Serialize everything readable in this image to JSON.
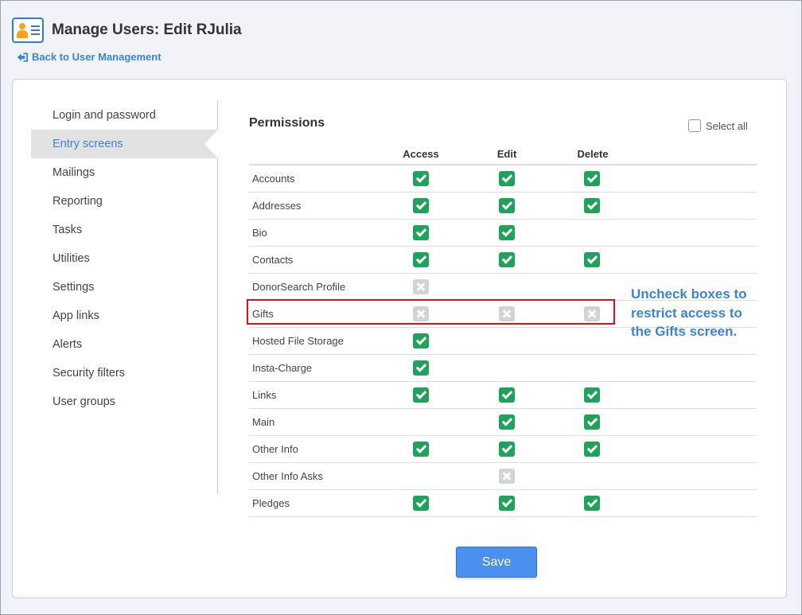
{
  "header": {
    "title": "Manage Users: Edit",
    "user": "RJulia",
    "back_label": "Back to User Management"
  },
  "sidebar": {
    "items": [
      {
        "label": "Login and password"
      },
      {
        "label": "Entry screens",
        "active": true
      },
      {
        "label": "Mailings"
      },
      {
        "label": "Reporting"
      },
      {
        "label": "Tasks"
      },
      {
        "label": "Utilities"
      },
      {
        "label": "Settings"
      },
      {
        "label": "App links"
      },
      {
        "label": "Alerts"
      },
      {
        "label": "Security filters"
      },
      {
        "label": "User groups"
      }
    ]
  },
  "permissions": {
    "title": "Permissions",
    "select_all_label": "Select all",
    "columns": [
      "Access",
      "Edit",
      "Delete"
    ],
    "rows": [
      {
        "name": "Accounts",
        "access": "on",
        "edit": "on",
        "delete": "on"
      },
      {
        "name": "Addresses",
        "access": "on",
        "edit": "on",
        "delete": "on"
      },
      {
        "name": "Bio",
        "access": "on",
        "edit": "on",
        "delete": null
      },
      {
        "name": "Contacts",
        "access": "on",
        "edit": "on",
        "delete": "on"
      },
      {
        "name": "DonorSearch Profile",
        "access": "off",
        "edit": null,
        "delete": null
      },
      {
        "name": "Gifts",
        "access": "off",
        "edit": "off",
        "delete": "off"
      },
      {
        "name": "Hosted File Storage",
        "access": "on",
        "edit": null,
        "delete": null
      },
      {
        "name": "Insta-Charge",
        "access": "on",
        "edit": null,
        "delete": null
      },
      {
        "name": "Links",
        "access": "on",
        "edit": "on",
        "delete": "on"
      },
      {
        "name": "Main",
        "access": null,
        "edit": "on",
        "delete": "on"
      },
      {
        "name": "Other Info",
        "access": "on",
        "edit": "on",
        "delete": "on"
      },
      {
        "name": "Other Info Asks",
        "access": null,
        "edit": "off",
        "delete": null
      },
      {
        "name": "Pledges",
        "access": "on",
        "edit": "on",
        "delete": "on"
      }
    ]
  },
  "callout": {
    "text": "Uncheck boxes to restrict access to the Gifts screen."
  },
  "save_label": "Save",
  "colors": {
    "accent": "#3a84d8",
    "checked": "#1fa25a",
    "unchecked": "#d3d3d3",
    "highlight": "#d9101a",
    "save_button": "#4a90ef"
  }
}
